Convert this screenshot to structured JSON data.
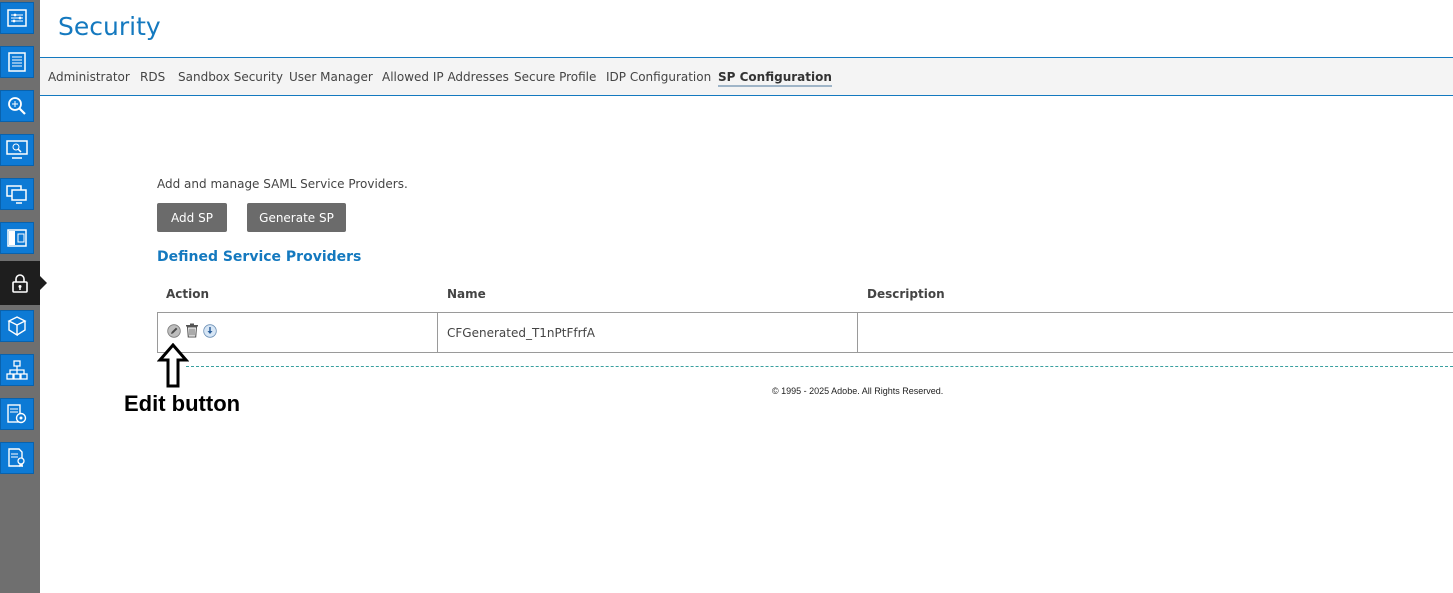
{
  "page": {
    "title": "Security"
  },
  "sidebar": {
    "items": [
      {
        "icon": "settings-panel-icon"
      },
      {
        "icon": "list-icon"
      },
      {
        "icon": "search-zoom-icon"
      },
      {
        "icon": "monitor-search-icon"
      },
      {
        "icon": "multiple-monitors-icon"
      },
      {
        "icon": "panel-layout-icon"
      },
      {
        "icon": "lock-icon",
        "active": true
      },
      {
        "icon": "packages-icon"
      },
      {
        "icon": "network-icon"
      },
      {
        "icon": "server-settings-icon"
      },
      {
        "icon": "certificate-icon"
      }
    ]
  },
  "tabs": [
    {
      "label": "Administrator"
    },
    {
      "label": "RDS"
    },
    {
      "label": "Sandbox Security"
    },
    {
      "label": "User Manager"
    },
    {
      "label": "Allowed IP Addresses"
    },
    {
      "label": "Secure Profile"
    },
    {
      "label": "IDP Configuration"
    },
    {
      "label": "SP Configuration",
      "active": true
    }
  ],
  "main": {
    "intro": "Add and manage SAML Service Providers.",
    "add_button": "Add SP",
    "generate_button": "Generate SP",
    "section_title": "Defined Service Providers",
    "table": {
      "columns": [
        "Action",
        "Name",
        "Description"
      ],
      "rows": [
        {
          "actions": [
            "edit-icon",
            "trash-icon",
            "download-icon"
          ],
          "name": "CFGenerated_T1nPtFfrfA",
          "description": ""
        }
      ]
    }
  },
  "footer": "© 1995 - 2025 Adobe. All Rights Reserved.",
  "annotation": {
    "label": "Edit button"
  },
  "colors": {
    "accent": "#1479bf",
    "sidebar": "#6f6f6f",
    "sidebar_button": "#0d7ad5",
    "button": "#6b6b6b"
  }
}
